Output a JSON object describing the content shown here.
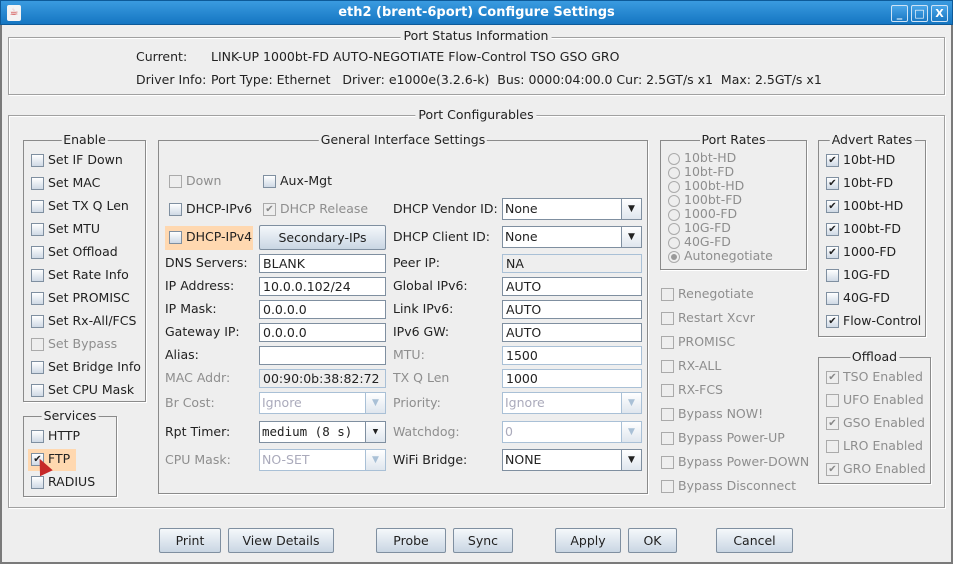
{
  "window": {
    "title": "eth2  (brent-6port) Configure Settings",
    "controls": [
      "_",
      "□",
      "X"
    ]
  },
  "status": {
    "title": "Port Status Information",
    "current_label": "Current:",
    "current_value": "LINK-UP 1000bt-FD AUTO-NEGOTIATE Flow-Control TSO GSO GRO",
    "driver_label": "Driver Info:",
    "driver_value": "Port Type: Ethernet   Driver: e1000e(3.2.6-k)  Bus: 0000:04:00.0 Cur: 2.5GT/s x1  Max: 2.5GT/s x1"
  },
  "config": {
    "title": "Port Configurables"
  },
  "enable": {
    "title": "Enable",
    "items": [
      {
        "label": "Set IF Down",
        "checked": false,
        "disabled": false
      },
      {
        "label": "Set MAC",
        "checked": false,
        "disabled": false
      },
      {
        "label": "Set TX Q Len",
        "checked": false,
        "disabled": false
      },
      {
        "label": "Set MTU",
        "checked": false,
        "disabled": false
      },
      {
        "label": "Set Offload",
        "checked": false,
        "disabled": false
      },
      {
        "label": "Set Rate Info",
        "checked": false,
        "disabled": false
      },
      {
        "label": "Set PROMISC",
        "checked": false,
        "disabled": false
      },
      {
        "label": "Set Rx-All/FCS",
        "checked": false,
        "disabled": false
      },
      {
        "label": "Set Bypass",
        "checked": false,
        "disabled": true
      },
      {
        "label": "Set Bridge Info",
        "checked": false,
        "disabled": false
      },
      {
        "label": "Set CPU Mask",
        "checked": false,
        "disabled": false
      }
    ]
  },
  "services": {
    "title": "Services",
    "items": [
      {
        "label": "HTTP",
        "checked": false,
        "disabled": false
      },
      {
        "label": "FTP",
        "checked": true,
        "disabled": false,
        "highlight": true
      },
      {
        "label": "RADIUS",
        "checked": false,
        "disabled": false
      }
    ]
  },
  "general": {
    "title": "General Interface Settings",
    "down": "Down",
    "aux_mgt": "Aux-Mgt",
    "dhcp_ipv6": "DHCP-IPv6",
    "dhcp_release": "DHCP Release",
    "dhcp_ipv4": "DHCP-IPv4",
    "secondary_ips": "Secondary-IPs",
    "dns_label": "DNS Servers:",
    "dns": "BLANK",
    "ip_label": "IP Address:",
    "ip": "10.0.0.102/24",
    "mask_label": "IP Mask:",
    "mask": "0.0.0.0",
    "gw_label": "Gateway IP:",
    "gw": "0.0.0.0",
    "alias_label": "Alias:",
    "alias": "",
    "mac_label": "MAC Addr:",
    "mac": "00:90:0b:38:82:72",
    "brcost_label": "Br Cost:",
    "brcost": "Ignore",
    "rpt_label": "Rpt Timer:",
    "rpt": "medium   (8 s)",
    "cpu_label": "CPU Mask:",
    "cpu": "NO-SET",
    "vendor_label": "DHCP Vendor ID:",
    "vendor": "None",
    "client_label": "DHCP Client ID:",
    "client": "None",
    "peer_label": "Peer IP:",
    "peer": "NA",
    "gipv6_label": "Global IPv6:",
    "gipv6": "AUTO",
    "lipv6_label": "Link IPv6:",
    "lipv6": "AUTO",
    "ipv6gw_label": "IPv6 GW:",
    "ipv6gw": "AUTO",
    "mtu_label": "MTU:",
    "mtu": "1500",
    "txq_label": "TX Q Len",
    "txq": "1000",
    "priority_label": "Priority:",
    "priority": "Ignore",
    "watchdog_label": "Watchdog:",
    "watchdog": "0",
    "wifi_label": "WiFi Bridge:",
    "wifi": "NONE"
  },
  "port_rates": {
    "title": "Port Rates",
    "options": [
      "10bt-HD",
      "10bt-FD",
      "100bt-HD",
      "100bt-FD",
      "1000-FD",
      "10G-FD",
      "40G-FD",
      "Autonegotiate"
    ],
    "selected": "Autonegotiate"
  },
  "misc": {
    "items": [
      {
        "label": "Renegotiate"
      },
      {
        "label": "Restart Xcvr"
      },
      {
        "label": "PROMISC"
      },
      {
        "label": "RX-ALL"
      },
      {
        "label": "RX-FCS"
      },
      {
        "label": "Bypass NOW!"
      },
      {
        "label": "Bypass Power-UP"
      },
      {
        "label": "Bypass Power-DOWN"
      },
      {
        "label": "Bypass Disconnect"
      }
    ]
  },
  "advert": {
    "title": "Advert Rates",
    "items": [
      {
        "label": "10bt-HD",
        "checked": true
      },
      {
        "label": "10bt-FD",
        "checked": true
      },
      {
        "label": "100bt-HD",
        "checked": true
      },
      {
        "label": "100bt-FD",
        "checked": true
      },
      {
        "label": "1000-FD",
        "checked": true
      },
      {
        "label": "10G-FD",
        "checked": false
      },
      {
        "label": "40G-FD",
        "checked": false
      },
      {
        "label": "Flow-Control",
        "checked": true
      }
    ]
  },
  "offload": {
    "title": "Offload",
    "items": [
      {
        "label": "TSO Enabled",
        "checked": true
      },
      {
        "label": "UFO Enabled",
        "checked": false
      },
      {
        "label": "GSO Enabled",
        "checked": true
      },
      {
        "label": "LRO Enabled",
        "checked": false
      },
      {
        "label": "GRO Enabled",
        "checked": true
      }
    ]
  },
  "buttons": {
    "print": "Print",
    "view_details": "View Details",
    "probe": "Probe",
    "sync": "Sync",
    "apply": "Apply",
    "ok": "OK",
    "cancel": "Cancel"
  },
  "colors": {
    "titlebar": "#1a7fc9",
    "highlight": "#ffd8b0"
  }
}
